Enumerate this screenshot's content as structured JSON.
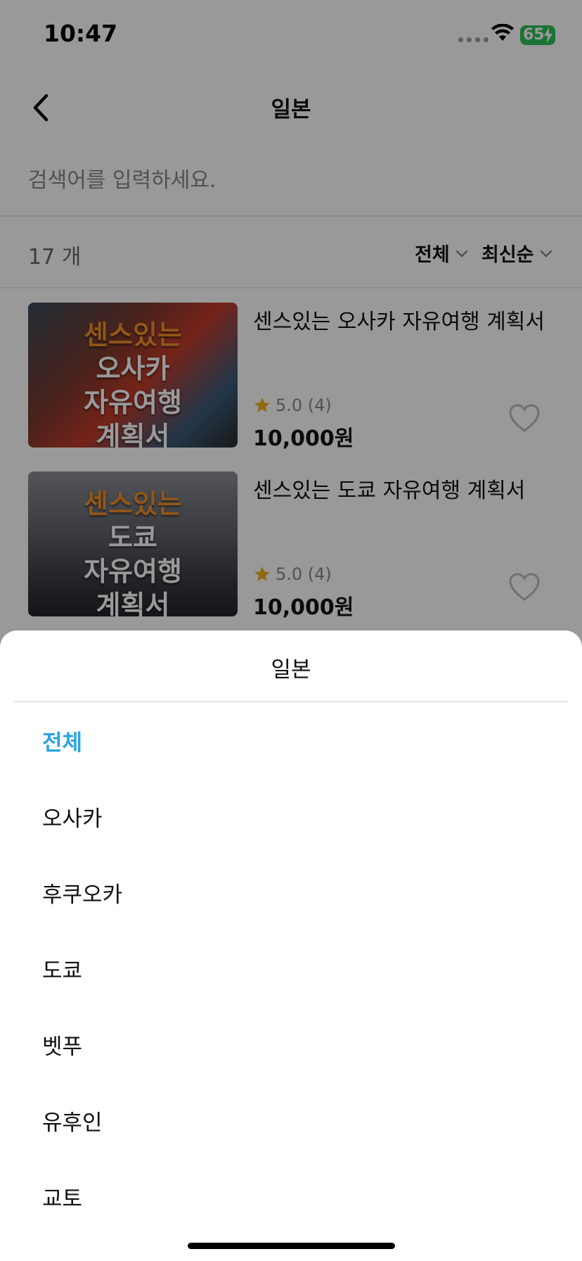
{
  "status_bar": {
    "time": "10:47",
    "battery": "65"
  },
  "navbar": {
    "title": "일본"
  },
  "search": {
    "placeholder": "검색어를 입력하세요."
  },
  "list_header": {
    "count": "17 개",
    "filter_region": "전체",
    "filter_sort": "최신순"
  },
  "products": [
    {
      "thumb_lines": [
        "센스있는",
        "오사카",
        "자유여행",
        "계획서"
      ],
      "title": "센스있는 오사카 자유여행 계획서",
      "rating": "5.0 (4)",
      "price": "10,000원"
    },
    {
      "thumb_lines": [
        "센스있는",
        "도쿄",
        "자유여행",
        "계획서"
      ],
      "title": "센스있는 도쿄 자유여행 계획서",
      "rating": "5.0 (4)",
      "price": "10,000원"
    }
  ],
  "sheet": {
    "title": "일본",
    "options": [
      "전체",
      "오사카",
      "후쿠오카",
      "도쿄",
      "벳푸",
      "유후인",
      "교토"
    ],
    "selected_color": "#2aa3e3"
  },
  "colors": {
    "star": "#f2b11a",
    "battery": "#2ec05a"
  }
}
